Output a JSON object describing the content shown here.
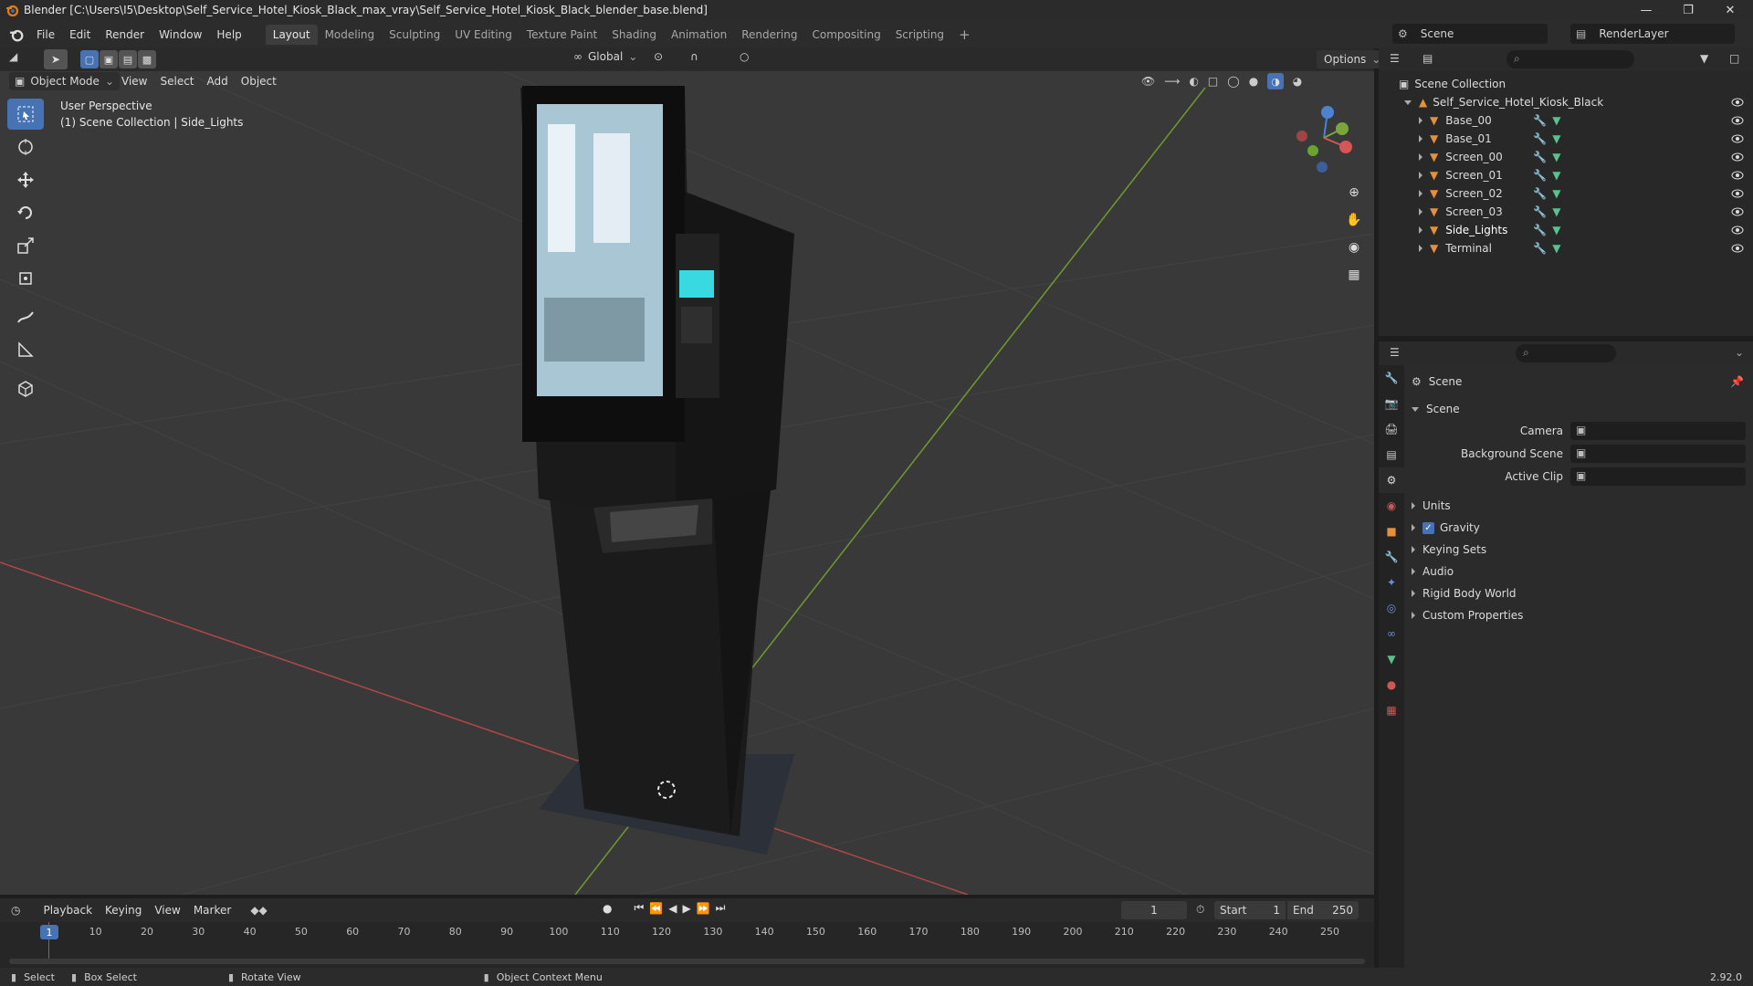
{
  "window": {
    "title": "Blender [C:\\Users\\I5\\Desktop\\Self_Service_Hotel_Kiosk_Black_max_vray\\Self_Service_Hotel_Kiosk_Black_blender_base.blend]",
    "controls": [
      "minimize",
      "maximize",
      "close"
    ]
  },
  "menubar": {
    "items": [
      "File",
      "Edit",
      "Render",
      "Window",
      "Help"
    ],
    "workspaces": [
      "Layout",
      "Modeling",
      "Sculpting",
      "UV Editing",
      "Texture Paint",
      "Shading",
      "Animation",
      "Rendering",
      "Compositing",
      "Scripting"
    ],
    "active_workspace": "Layout",
    "scene_name": "Scene",
    "view_layer": "RenderLayer"
  },
  "viewport_header": {
    "mode": "Object Mode",
    "menus": [
      "View",
      "Select",
      "Add",
      "Object"
    ],
    "transform_orientation": "Global",
    "options_label": "Options"
  },
  "viewport": {
    "perspective_label": "User Perspective",
    "collection_label": "(1) Scene Collection | Side_Lights",
    "gizmo_axes": [
      "X",
      "Y",
      "Z"
    ]
  },
  "tools": [
    {
      "name": "select-box-icon",
      "active": true
    },
    {
      "name": "cursor-icon"
    },
    {
      "name": "move-icon"
    },
    {
      "name": "rotate-icon"
    },
    {
      "name": "scale-icon"
    },
    {
      "name": "transform-icon"
    },
    {
      "name": "annotate-icon"
    },
    {
      "name": "measure-icon"
    },
    {
      "name": "add-cube-icon"
    }
  ],
  "outliner": {
    "root": "Scene Collection",
    "collection": "Self_Service_Hotel_Kiosk_Black",
    "objects": [
      "Base_00",
      "Base_01",
      "Screen_00",
      "Screen_01",
      "Screen_02",
      "Screen_03",
      "Side_Lights",
      "Terminal"
    ],
    "selected": "Side_Lights"
  },
  "properties": {
    "context_title": "Scene",
    "section": "Scene",
    "fields": [
      {
        "label": "Camera",
        "value": ""
      },
      {
        "label": "Background Scene",
        "value": ""
      },
      {
        "label": "Active Clip",
        "value": ""
      }
    ],
    "panels": [
      {
        "label": "Units",
        "checkbox": false
      },
      {
        "label": "Gravity",
        "checkbox": true
      },
      {
        "label": "Keying Sets",
        "checkbox": false
      },
      {
        "label": "Audio",
        "checkbox": false
      },
      {
        "label": "Rigid Body World",
        "checkbox": false
      },
      {
        "label": "Custom Properties",
        "checkbox": false
      }
    ]
  },
  "timeline": {
    "menus": [
      "Playback",
      "Keying",
      "View",
      "Marker"
    ],
    "current_frame": "1",
    "start_label": "Start",
    "start": "1",
    "end_label": "End",
    "end": "250",
    "ticks": [
      "1",
      "10",
      "20",
      "30",
      "40",
      "50",
      "60",
      "70",
      "80",
      "90",
      "100",
      "110",
      "120",
      "130",
      "140",
      "150",
      "160",
      "170",
      "180",
      "190",
      "200",
      "210",
      "220",
      "230",
      "240",
      "250"
    ]
  },
  "statusbar": {
    "select": "Select",
    "box_select": "Box Select",
    "rotate_view": "Rotate View",
    "context_menu": "Object Context Menu",
    "version": "2.92.0"
  },
  "colors": {
    "accent": "#4772b3",
    "x_axis": "#b04747",
    "y_axis": "#6f9a2f",
    "object_orange": "#e3913b"
  }
}
